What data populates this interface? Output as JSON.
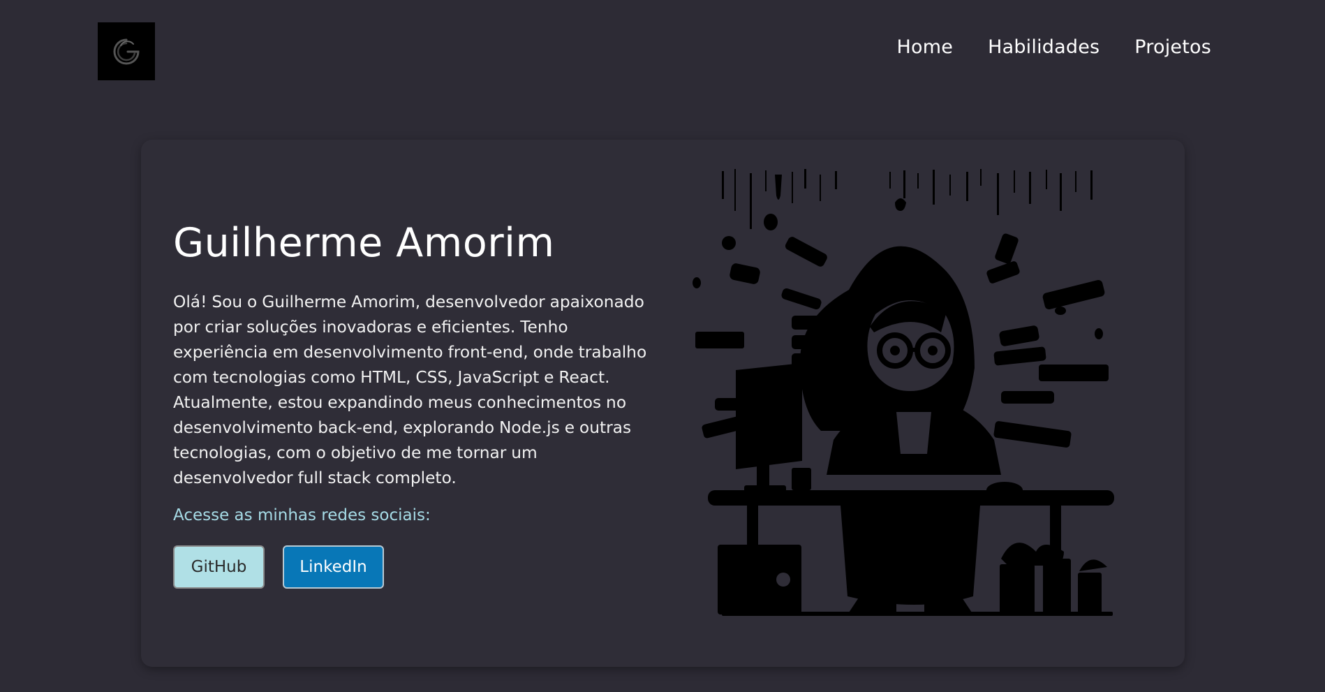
{
  "header": {
    "logo_icon": "g-logo-icon",
    "nav": [
      {
        "label": "Home"
      },
      {
        "label": "Habilidades"
      },
      {
        "label": "Projetos"
      }
    ]
  },
  "hero": {
    "name": "Guilherme Amorim",
    "bio": "Olá! Sou o Guilherme Amorim, desenvolvedor apaixonado por criar soluções inovadoras e eficientes. Tenho experiência em desenvolvimento front-end, onde trabalho com tecnologias como HTML, CSS, JavaScript e React. Atualmente, estou expandindo meus conhecimentos no desenvolvimento back-end, explorando Node.js e outras tecnologias, com o objetivo de me tornar um desenvolvedor full stack completo.",
    "social_label": "Acesse as minhas redes sociais:",
    "github_label": "GitHub",
    "linkedin_label": "LinkedIn",
    "illustration_icon": "developer-illustration"
  },
  "colors": {
    "background": "#2d2b35",
    "card": "#2f2d37",
    "accent_text": "#a6dbe6",
    "github_button": "#b0e0e6",
    "linkedin_button": "#0877b7"
  }
}
